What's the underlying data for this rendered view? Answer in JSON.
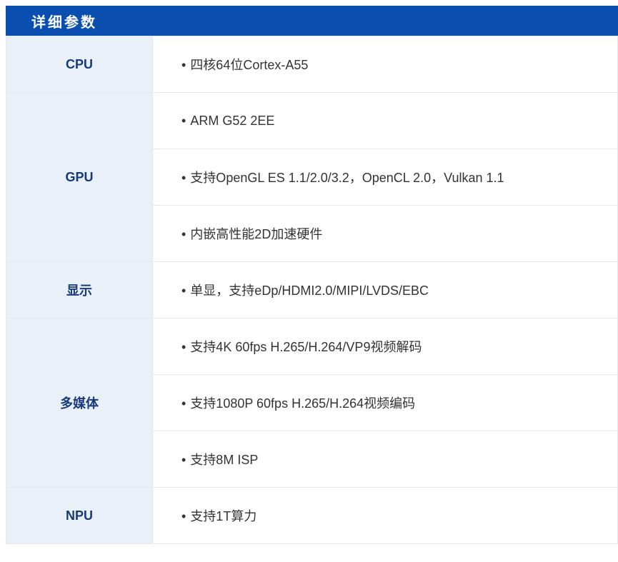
{
  "header": {
    "title": "详细参数"
  },
  "bullet": "•",
  "specs": [
    {
      "label": "CPU",
      "values": [
        "四核64位Cortex-A55"
      ]
    },
    {
      "label": "GPU",
      "values": [
        "ARM G52 2EE",
        "支持OpenGL ES 1.1/2.0/3.2，OpenCL 2.0，Vulkan 1.1",
        "内嵌高性能2D加速硬件"
      ]
    },
    {
      "label": "显示",
      "values": [
        "单显，支持eDp/HDMI2.0/MIPI/LVDS/EBC"
      ]
    },
    {
      "label": "多媒体",
      "values": [
        "支持4K 60fps H.265/H.264/VP9视频解码",
        "支持1080P 60fps H.265/H.264视频编码",
        "支持8M ISP"
      ]
    },
    {
      "label": "NPU",
      "values": [
        "支持1T算力"
      ]
    }
  ],
  "colors": {
    "header_bg": "#0a4fb0",
    "label_bg": "#eaf0f8",
    "label_text": "#173a7a",
    "value_text": "#333333"
  }
}
